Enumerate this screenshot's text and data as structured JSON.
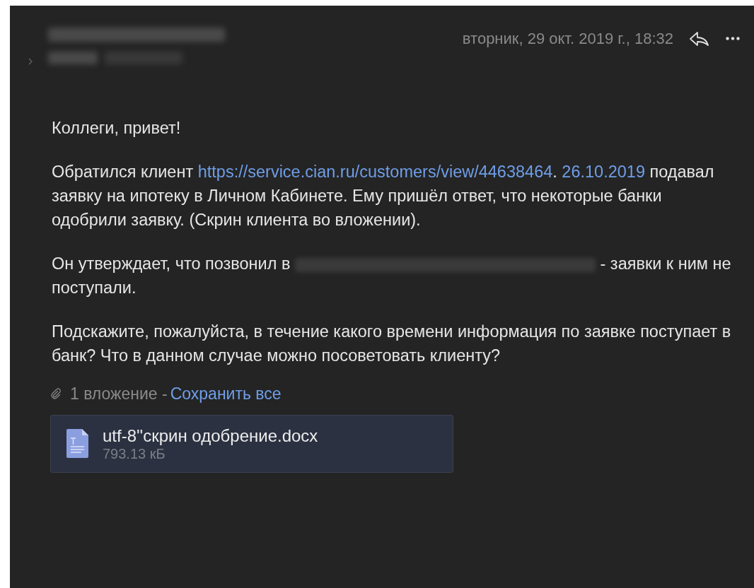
{
  "header": {
    "date": "вторник, 29 окт. 2019 г., 18:32"
  },
  "paragraphs": [
    [
      {
        "kind": "text",
        "text": "Коллеги, привет!"
      }
    ],
    [
      {
        "kind": "text",
        "text": "Обратился клиент "
      },
      {
        "kind": "link",
        "text": "https://service.cian.ru/customers/view/44638464"
      },
      {
        "kind": "text",
        "text": ". "
      },
      {
        "kind": "link",
        "text": "26.10.2019"
      },
      {
        "kind": "text",
        "text": " подавал заявку на ипотеку в Личном Кабинете. Ему пришёл ответ, что некоторые банки одобрили заявку. (Скрин клиента во вложении)."
      }
    ],
    [
      {
        "kind": "text",
        "text": "Он утверждает, что позвонил в "
      },
      {
        "kind": "redaction"
      },
      {
        "kind": "text",
        "text": " - заявки к ним не поступали."
      }
    ],
    [
      {
        "kind": "text",
        "text": "Подскажите, пожалуйста, в течение какого времени информация по заявке поступает в банк? Что в данном случае можно посоветовать клиенту?"
      }
    ]
  ],
  "attachments_summary": {
    "count": "1 вложение -",
    "save_all": "Сохранить все"
  },
  "attachments": [
    {
      "name": "utf-8''скрин одобрение.docx",
      "size": "793.13 кБ"
    }
  ]
}
